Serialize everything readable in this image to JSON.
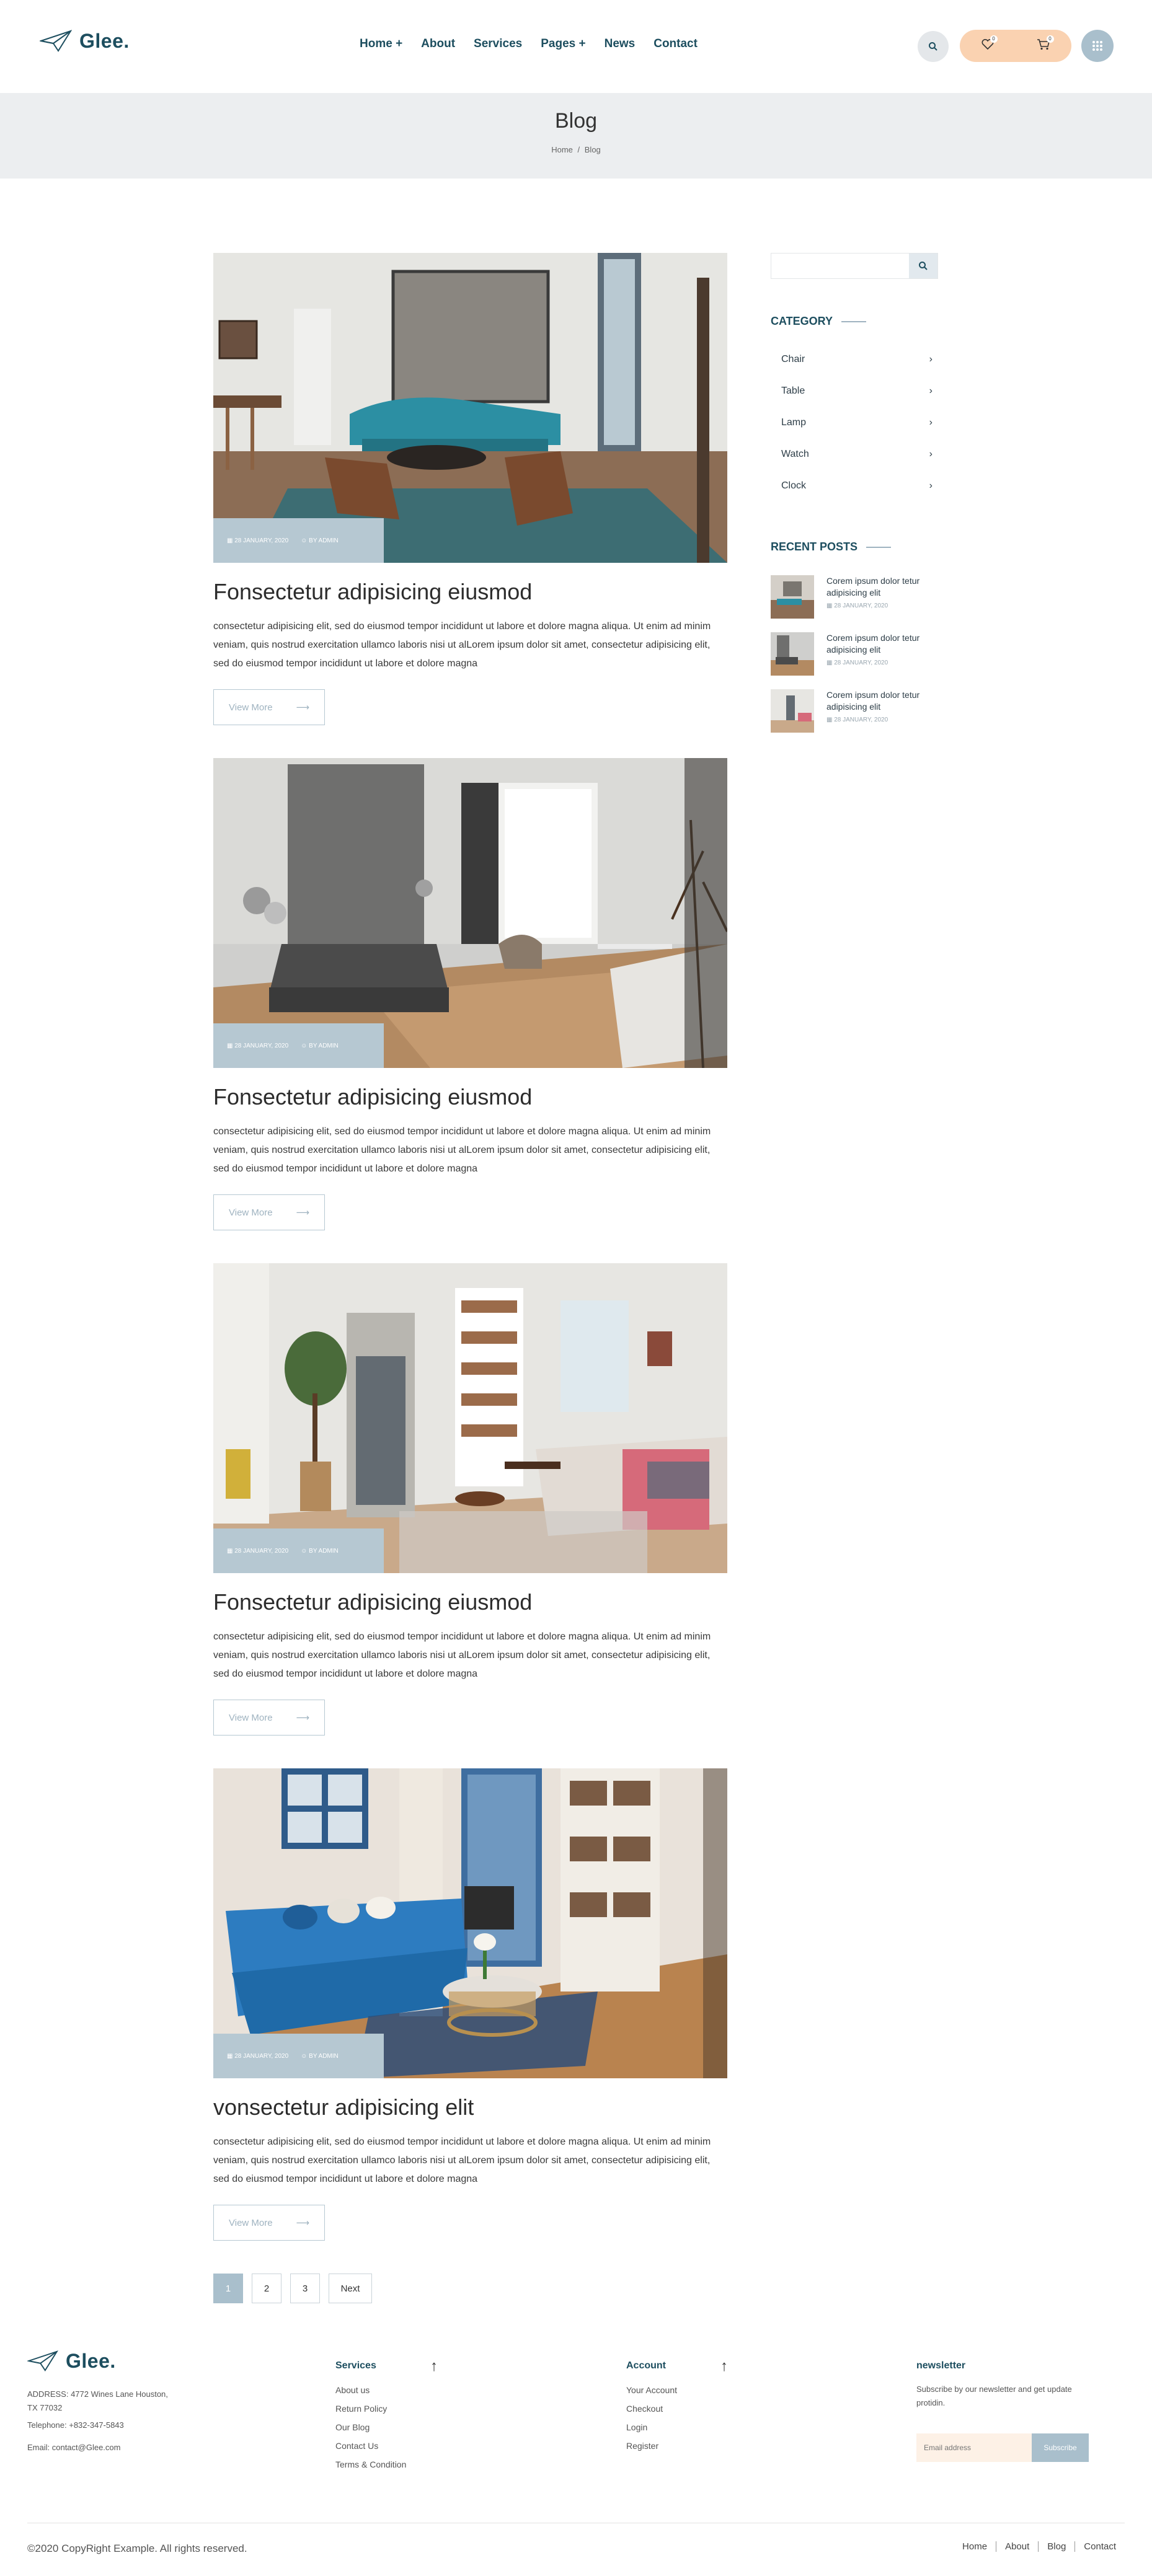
{
  "header": {
    "logo": "Glee.",
    "nav": [
      "Home +",
      "About",
      "Services",
      "Pages +",
      "News",
      "Contact"
    ],
    "wishlist_count": "0",
    "cart_count": "0"
  },
  "banner": {
    "title": "Blog",
    "crumb_home": "Home",
    "crumb_sep": "/",
    "crumb_current": "Blog"
  },
  "posts": [
    {
      "date": "28 JANUARY, 2020",
      "author": "BY ADMIN",
      "title": "Fonsectetur adipisicing eiusmod",
      "text": "consectetur adipisicing elit, sed do eiusmod tempor incididunt ut labore et dolore magna aliqua. Ut enim ad minim veniam, quis nostrud exercitation ullamco laboris nisi ut alLorem ipsum dolor sit amet, consectetur adipisicing elit, sed do eiusmod tempor incididunt ut labore et dolore magna",
      "button": "View More"
    },
    {
      "date": "28 JANUARY, 2020",
      "author": "BY ADMIN",
      "title": "Fonsectetur adipisicing eiusmod",
      "text": "consectetur adipisicing elit, sed do eiusmod tempor incididunt ut labore et dolore magna aliqua. Ut enim ad minim veniam, quis nostrud exercitation ullamco laboris nisi ut alLorem ipsum dolor sit amet, consectetur adipisicing elit, sed do eiusmod tempor incididunt ut labore et dolore magna",
      "button": "View More"
    },
    {
      "date": "28 JANUARY, 2020",
      "author": "BY ADMIN",
      "title": "Fonsectetur adipisicing eiusmod",
      "text": "consectetur adipisicing elit, sed do eiusmod tempor incididunt ut labore et dolore magna aliqua. Ut enim ad minim veniam, quis nostrud exercitation ullamco laboris nisi ut alLorem ipsum dolor sit amet, consectetur adipisicing elit, sed do eiusmod tempor incididunt ut labore et dolore magna",
      "button": "View More"
    },
    {
      "date": "28 JANUARY, 2020",
      "author": "BY ADMIN",
      "title": "vonsectetur adipisicing elit",
      "text": "consectetur adipisicing elit, sed do eiusmod tempor incididunt ut labore et dolore magna aliqua. Ut enim ad minim veniam, quis nostrud exercitation ullamco laboris nisi ut alLorem ipsum dolor sit amet, consectetur adipisicing elit, sed do eiusmod tempor incididunt ut labore et dolore magna",
      "button": "View More"
    }
  ],
  "sidebar": {
    "search_placeholder": "",
    "category_title": "CATEGORY",
    "categories": [
      "Chair",
      "Table",
      "Lamp",
      "Watch",
      "Clock"
    ],
    "recent_title": "RECENT POSTS",
    "recent": [
      {
        "title": "Corem ipsum dolor tetur adipisicing elit",
        "date": "28 JANUARY, 2020"
      },
      {
        "title": "Corem ipsum dolor tetur adipisicing elit",
        "date": "28 JANUARY, 2020"
      },
      {
        "title": "Corem ipsum dolor tetur adipisicing elit",
        "date": "28 JANUARY, 2020"
      }
    ]
  },
  "pagination": {
    "pages": [
      "1",
      "2",
      "3"
    ],
    "next": "Next",
    "active": "1"
  },
  "footer": {
    "logo": "Glee.",
    "address": "ADDRESS: 4772 Wines Lane Houston, TX 77032",
    "telephone": "Telephone: +832-347-5843",
    "email": "Email: contact@Glee.com",
    "services_title": "Services",
    "services": [
      "About us",
      "Return Policy",
      "Our Blog",
      "Contact Us",
      "Terms & Condition"
    ],
    "account_title": "Account",
    "account": [
      "Your Account",
      "Checkout",
      "Login",
      "Register"
    ],
    "newsletter_title": "newsletter",
    "newsletter_text": "Subscribe by our newsletter and get update protidin.",
    "email_placeholder": "Email address",
    "subscribe": "Subscribe",
    "copyright": "©2020 CopyRight Example. All rights reserved.",
    "bottom_links": [
      "Home",
      "About",
      "Blog",
      "Contact"
    ]
  },
  "colors": {
    "brand": "#1d4e5f",
    "accent": "#a9bfcc",
    "pill": "#fad2b1"
  }
}
